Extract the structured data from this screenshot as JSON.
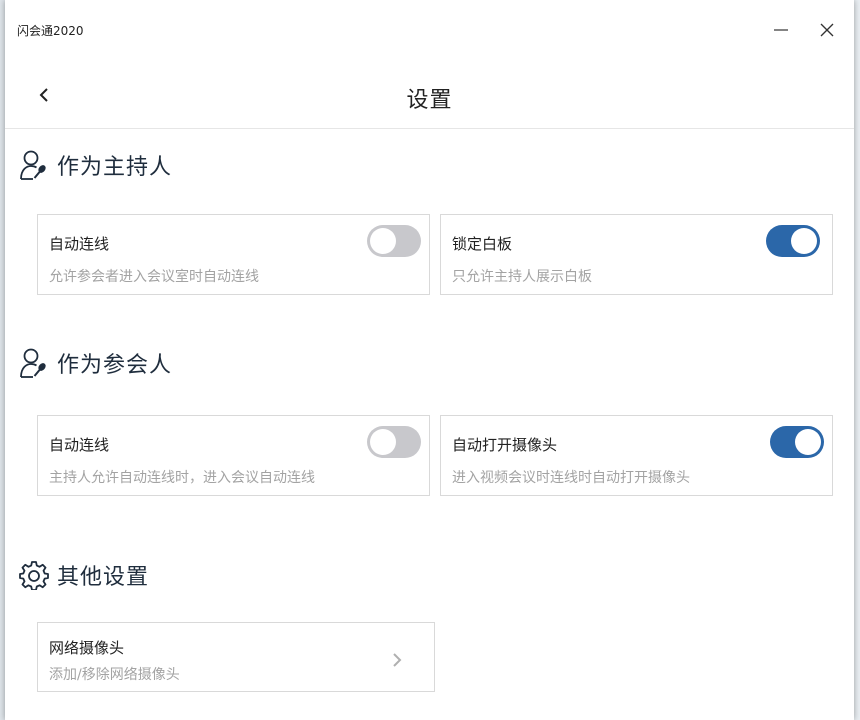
{
  "window": {
    "title": "闪会通2020",
    "minimize_icon": "minimize-icon",
    "close_icon": "close-icon"
  },
  "header": {
    "title": "设置",
    "back_icon": "chevron-left-icon"
  },
  "sections": {
    "host": {
      "title": "作为主持人",
      "icon": "user-mic-icon",
      "cards": [
        {
          "title": "自动连线",
          "desc": "允许参会者进入会议室时自动连线",
          "toggle": "off"
        },
        {
          "title": "锁定白板",
          "desc": "只允许主持人展示白板",
          "toggle": "on"
        }
      ]
    },
    "participant": {
      "title": "作为参会人",
      "icon": "user-mic-icon",
      "cards": [
        {
          "title": "自动连线",
          "desc": "主持人允许自动连线时，进入会议自动连线",
          "toggle": "off"
        },
        {
          "title": "自动打开摄像头",
          "desc": "进入视频会议时连线时自动打开摄像头",
          "toggle": "on"
        }
      ]
    },
    "other": {
      "title": "其他设置",
      "icon": "gear-icon",
      "cards": [
        {
          "title": "网络摄像头",
          "desc": "添加/移除网络摄像头",
          "nav_icon": "chevron-right-icon"
        }
      ]
    }
  },
  "colors": {
    "accent": "#2b67a9",
    "toggle_off": "#c8c8cc",
    "desc_text": "#a3a3a3",
    "section_text": "#1f2d3d"
  }
}
